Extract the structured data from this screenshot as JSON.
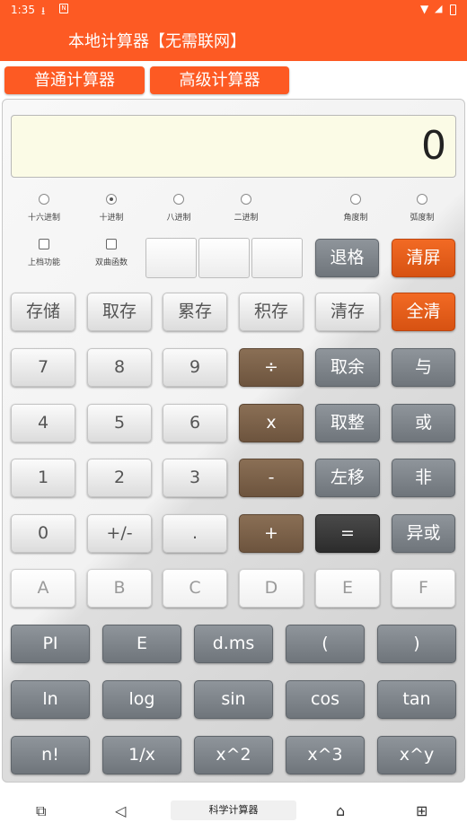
{
  "status": {
    "time": "1:35"
  },
  "app": {
    "title": "本地计算器【无需联网】"
  },
  "tabs": [
    "普通计算器",
    "高级计算器"
  ],
  "display": {
    "value": "0"
  },
  "base_options": [
    "十六进制",
    "十进制",
    "八进制",
    "二进制"
  ],
  "angle_options": [
    "角度制",
    "弧度制"
  ],
  "selected_base": "十进制",
  "checkboxes": [
    "上档功能",
    "双曲函数"
  ],
  "buttons": {
    "backspace": "退格",
    "clear_screen": "清屏",
    "memory": [
      "存储",
      "取存",
      "累存",
      "积存",
      "清存"
    ],
    "clear_all": "全清",
    "row7": [
      "7",
      "8",
      "9",
      "÷",
      "取余",
      "与"
    ],
    "row4": [
      "4",
      "5",
      "6",
      "x",
      "取整",
      "或"
    ],
    "row1": [
      "1",
      "2",
      "3",
      "-",
      "左移",
      "非"
    ],
    "row0": [
      "0",
      "+/-",
      ".",
      "+",
      "=",
      "异或"
    ],
    "hex": [
      "A",
      "B",
      "C",
      "D",
      "E",
      "F"
    ],
    "sci1": [
      "PI",
      "E",
      "d.ms",
      "(",
      ")"
    ],
    "sci2": [
      "ln",
      "log",
      "sin",
      "cos",
      "tan"
    ],
    "sci3": [
      "n!",
      "1/x",
      "x^2",
      "x^3",
      "x^y"
    ]
  },
  "nav": {
    "label": "科学计算器"
  },
  "colors": {
    "accent": "#fd5a23",
    "display_bg": "#fbfbe6"
  }
}
